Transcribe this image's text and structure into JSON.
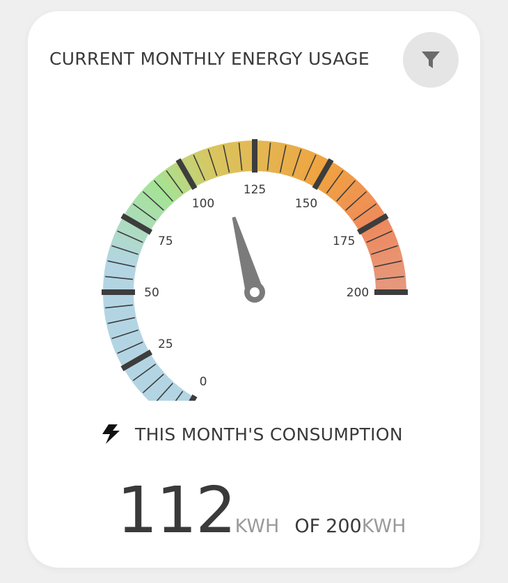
{
  "card": {
    "title": "CURRENT MONTHLY ENERGY USAGE",
    "filter_icon": "filter-icon"
  },
  "gauge": {
    "min": 0,
    "max": 200,
    "value": 112,
    "tick_labels": [
      "0",
      "25",
      "50",
      "75",
      "100",
      "125",
      "150",
      "175",
      "200"
    ],
    "start_angle_deg": 240,
    "sweep_deg": 240,
    "colors": {
      "low": "#b3d5e3",
      "green": "#a5e394",
      "yellow": "#d9c660",
      "orange": "#f0a23f",
      "red": "#ee8a5e",
      "high": "#e49a80",
      "needle": "#7b7b7b",
      "ticks": "#3d3d3d"
    }
  },
  "consumption": {
    "icon": "lightning-bolt-icon",
    "label": "THIS MONTH'S CONSUMPTION",
    "value": "112",
    "unit": "KWH",
    "of_label": "OF",
    "max_value": "200",
    "max_unit": "KWH"
  }
}
